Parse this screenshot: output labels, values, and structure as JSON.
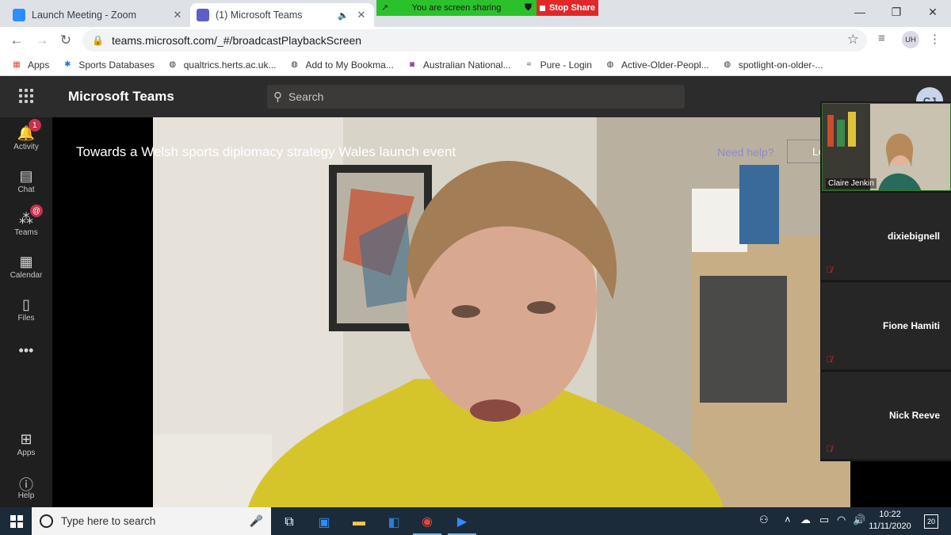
{
  "browser": {
    "tabs": [
      {
        "title": "Launch Meeting - Zoom",
        "favicon_color": "#2d8cff"
      },
      {
        "title": "(1) Microsoft Teams",
        "favicon_color": "#5b5fc7"
      }
    ],
    "url": "teams.microsoft.com/_#/broadcastPlaybackScreen",
    "profile_initials": "UH"
  },
  "zoom_share": {
    "status": "You are screen sharing",
    "stop_label": "Stop Share"
  },
  "bookmarks": [
    {
      "label": "Apps",
      "icon": "apps-grid-icon"
    },
    {
      "label": "Sports Databases",
      "icon": "sports-icon"
    },
    {
      "label": "qualtrics.herts.ac.uk...",
      "icon": "globe-icon"
    },
    {
      "label": "Add to My Bookma...",
      "icon": "globe-icon"
    },
    {
      "label": "Australian National...",
      "icon": "anu-icon"
    },
    {
      "label": "Pure - Login",
      "icon": "pure-icon"
    },
    {
      "label": "Active-Older-Peopl...",
      "icon": "globe-icon"
    },
    {
      "label": "spotlight-on-older-...",
      "icon": "globe-icon"
    }
  ],
  "teams": {
    "app_title": "Microsoft Teams",
    "search_placeholder": "Search",
    "user_initials": "CJ",
    "event_title": "Towards a Welsh sports diplomacy strategy Wales launch event",
    "need_help": "Need help?",
    "leave_label": "Leave",
    "rail": [
      {
        "label": "Activity",
        "badge": "1"
      },
      {
        "label": "Chat"
      },
      {
        "label": "Teams",
        "badge": "@"
      },
      {
        "label": "Calendar"
      },
      {
        "label": "Files"
      },
      {
        "label": "Apps"
      },
      {
        "label": "Help"
      }
    ]
  },
  "zoom_participants": {
    "self_name": "Claire Jenkin",
    "others": [
      "dixiebignell",
      "Fione Hamiti",
      "Nick Reeve"
    ]
  },
  "taskbar": {
    "search_placeholder": "Type here to search",
    "time": "10:22",
    "date": "11/11/2020",
    "notifications": "20"
  }
}
